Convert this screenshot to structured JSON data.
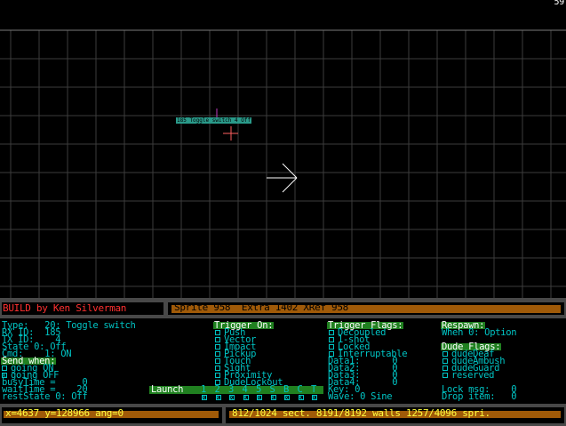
{
  "viewport": {
    "fps": "59",
    "sprite_tag": "185 Toggle switch 4 Off",
    "colors": {
      "grid": "#3c3c3c",
      "grid_strong": "#7a7a7a",
      "sprite": "#ff6060",
      "marker": "#c03cc0",
      "player": "#ffffff"
    }
  },
  "header": {
    "title": "BUILD by Ken Silverman",
    "stats": "Sprite 958  Extra 1402 XRef 958"
  },
  "info": {
    "col1": {
      "type_line": "Type:   20: Toggle switch",
      "rx_line": "RX ID:  185",
      "tx_line": "TX ID:    4",
      "state_line": "State 0: Off",
      "cmd_line": "Cmd:    1: ON",
      "send_when": "Send when:",
      "going_on": "going ON",
      "going_off": "going OFF",
      "busy_line": "busyTime =     0",
      "wait_line": "waitTime =    20",
      "rest_line": "restState 0: Off"
    },
    "col2": {
      "trigger_on": "Trigger On:",
      "items": [
        "Push",
        "Vector",
        "Impact",
        "Pickup",
        "Touch",
        "Sight",
        "Proximity",
        "DudeLockout"
      ]
    },
    "col3": {
      "trigger_flags": "Trigger Flags:",
      "flags": [
        "Decoupled",
        "1-shot",
        "Locked",
        "Interruptable"
      ],
      "data": [
        "Data1:      0",
        "Data2:      0",
        "Data3:      0",
        "Data4:      0"
      ],
      "key_line": "Key: 0",
      "wave_line": "Wave: 0 Sine"
    },
    "col4": {
      "respawn": "Respawn:",
      "when_line": "When 0: Option",
      "dude_flags": "Dude Flags:",
      "dude_items": [
        "dudeDeaf",
        "dudeAmbush",
        "dudeGuard",
        "reserved"
      ],
      "lock_line": "Lock msg:    0",
      "drop_line": "Drop item:   0"
    },
    "launch": {
      "label": "Launch",
      "slots": [
        "1",
        "2",
        "3",
        "4",
        "5",
        "S",
        "B",
        "C",
        "T"
      ]
    }
  },
  "footer": {
    "coords": "x=4637 y=128966 ang=0",
    "counts": "812/1024 sect. 8191/8192 walls 1257/4096 spri."
  }
}
